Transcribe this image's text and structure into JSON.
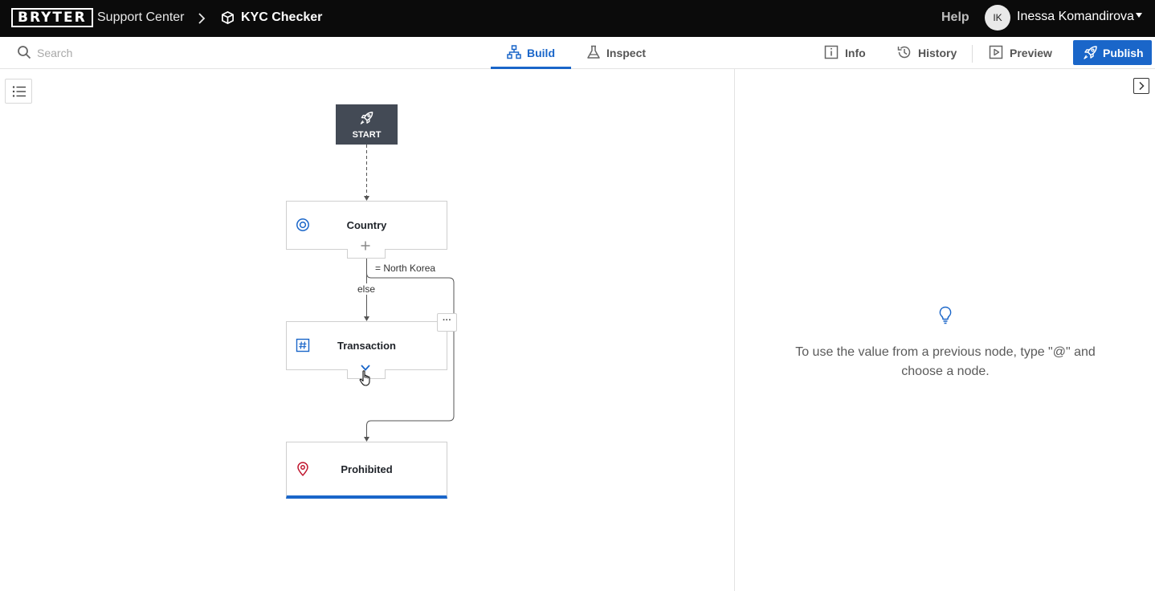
{
  "header": {
    "logo": "BRYTER",
    "breadcrumb_parent": "Support Center",
    "breadcrumb_current": "KYC Checker",
    "help_label": "Help",
    "avatar_initials": "IK",
    "user_name": "Inessa Komandirova"
  },
  "toolbar": {
    "search_placeholder": "Search",
    "tabs": [
      {
        "label": "Build",
        "active": true
      },
      {
        "label": "Inspect",
        "active": false
      }
    ],
    "info_label": "Info",
    "history_label": "History",
    "preview_label": "Preview",
    "publish_label": "Publish"
  },
  "flow": {
    "start_label": "START",
    "nodes": [
      {
        "label": "Country",
        "icon": "radio-icon"
      },
      {
        "label": "Transaction",
        "icon": "hash-icon"
      },
      {
        "label": "Prohibited",
        "icon": "map-pin-icon"
      }
    ],
    "edges": {
      "condition_label": "= North Korea",
      "else_label": "else"
    },
    "node_menu_label": "···"
  },
  "panel": {
    "hint_text": "To use the value from a previous node, type \"@\" and choose a node."
  },
  "colors": {
    "accent": "#1a66c9",
    "topbar": "#0b0b0b",
    "start_node": "#434a55",
    "end_icon": "#c0172f"
  }
}
